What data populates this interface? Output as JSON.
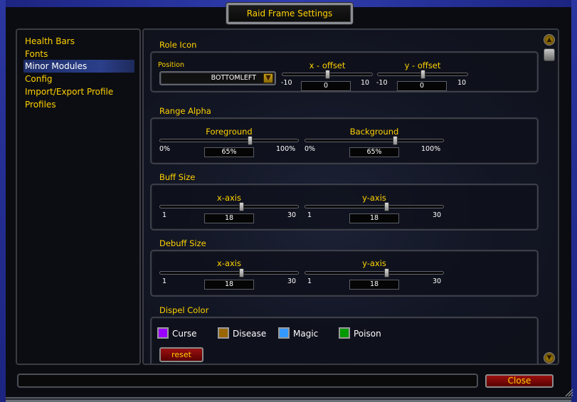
{
  "window": {
    "title": "Raid Frame Settings"
  },
  "sidebar": {
    "items": [
      {
        "label": "Health Bars"
      },
      {
        "label": "Fonts"
      },
      {
        "label": "Minor Modules"
      },
      {
        "label": "Config"
      },
      {
        "label": "Import/Export Profile"
      },
      {
        "label": "Profiles"
      }
    ],
    "selected": "Minor Modules"
  },
  "role_icon": {
    "title": "Role Icon",
    "position": {
      "label": "Position",
      "value": "BOTTOMLEFT"
    },
    "x_offset": {
      "label": "x - offset",
      "min": "-10",
      "max": "10",
      "value": "0",
      "fraction": 0.5
    },
    "y_offset": {
      "label": "y - offset",
      "min": "-10",
      "max": "10",
      "value": "0",
      "fraction": 0.5
    }
  },
  "range_alpha": {
    "title": "Range Alpha",
    "foreground": {
      "label": "Foreground",
      "min": "0%",
      "max": "100%",
      "value": "65%",
      "fraction": 0.65
    },
    "background": {
      "label": "Background",
      "min": "0%",
      "max": "100%",
      "value": "65%",
      "fraction": 0.65
    }
  },
  "buff_size": {
    "title": "Buff Size",
    "x_axis": {
      "label": "x-axis",
      "min": "1",
      "max": "30",
      "value": "18",
      "fraction": 0.586
    },
    "y_axis": {
      "label": "y-axis",
      "min": "1",
      "max": "30",
      "value": "18",
      "fraction": 0.586
    }
  },
  "debuff_size": {
    "title": "Debuff Size",
    "x_axis": {
      "label": "x-axis",
      "min": "1",
      "max": "30",
      "value": "18",
      "fraction": 0.586
    },
    "y_axis": {
      "label": "y-axis",
      "min": "1",
      "max": "30",
      "value": "18",
      "fraction": 0.586
    }
  },
  "dispel_color": {
    "title": "Dispel Color",
    "colors": [
      {
        "label": "Curse",
        "color": "#9900ff"
      },
      {
        "label": "Disease",
        "color": "#996600"
      },
      {
        "label": "Magic",
        "color": "#3399ff"
      },
      {
        "label": "Poison",
        "color": "#009900"
      }
    ],
    "reset_label": "reset"
  },
  "footer": {
    "close_label": "Close"
  },
  "theme": {
    "gold": "#ffd100",
    "button_red": "#8a0a0a",
    "selected": "#2b3f8a"
  }
}
